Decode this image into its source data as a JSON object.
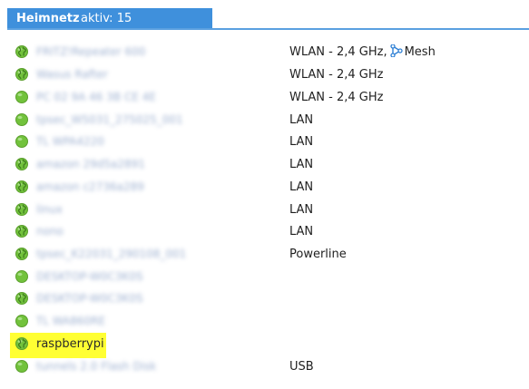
{
  "header": {
    "title": "Heimnetz",
    "count_text": "aktiv: 15"
  },
  "colors": {
    "header_bg": "#3f90dc",
    "status_ok": "#72c23c",
    "highlight": "#ffff33",
    "mesh_icon": "#2d7fd4"
  },
  "devices": [
    {
      "name": "FRITZ!Repeater 600",
      "connection": "WLAN - 2,4 GHz,",
      "mesh": "Mesh",
      "status_icon": "globe-green-icon",
      "name_blurred": true
    },
    {
      "name": "Wasus Rafter",
      "connection": "WLAN - 2,4 GHz",
      "status_icon": "globe-green-icon",
      "name_blurred": true
    },
    {
      "name": "PC 02 9A 46 3B CE 4E",
      "connection": "WLAN - 2,4 GHz",
      "status_icon": "dot-green-icon",
      "name_blurred": true
    },
    {
      "name": "tpsec_W5031_275025_001",
      "connection": "LAN",
      "status_icon": "dot-green-icon",
      "name_blurred": true
    },
    {
      "name": "TL WPA4220",
      "connection": "LAN",
      "status_icon": "dot-green-icon",
      "name_blurred": true
    },
    {
      "name": "amazon 29d5a2891",
      "connection": "LAN",
      "status_icon": "globe-green-icon",
      "name_blurred": true
    },
    {
      "name": "amazon c2736a289",
      "connection": "LAN",
      "status_icon": "globe-green-icon",
      "name_blurred": true
    },
    {
      "name": "linux",
      "connection": "LAN",
      "status_icon": "globe-green-icon",
      "name_blurred": true
    },
    {
      "name": "nono",
      "connection": "LAN",
      "status_icon": "globe-green-icon",
      "name_blurred": true
    },
    {
      "name": "tpsec_K22031_290108_001",
      "connection": "Powerline",
      "status_icon": "globe-green-icon",
      "name_blurred": true
    },
    {
      "name": "DESKTOP-W0C3K0S",
      "connection": "",
      "status_icon": "dot-green-icon",
      "name_blurred": true
    },
    {
      "name": "DESKTOP-W0C3K0S",
      "connection": "",
      "status_icon": "globe-green-icon",
      "name_blurred": true
    },
    {
      "name": "TL WA860RE",
      "connection": "",
      "status_icon": "dot-green-icon",
      "name_blurred": true
    },
    {
      "name": "raspberrypi",
      "connection": "",
      "status_icon": "globe-green-icon",
      "name_blurred": false,
      "highlighted": true
    },
    {
      "name": "tunnels 2.0 Flash Disk",
      "connection": "USB",
      "status_icon": "dot-green-icon",
      "name_blurred": true
    }
  ]
}
